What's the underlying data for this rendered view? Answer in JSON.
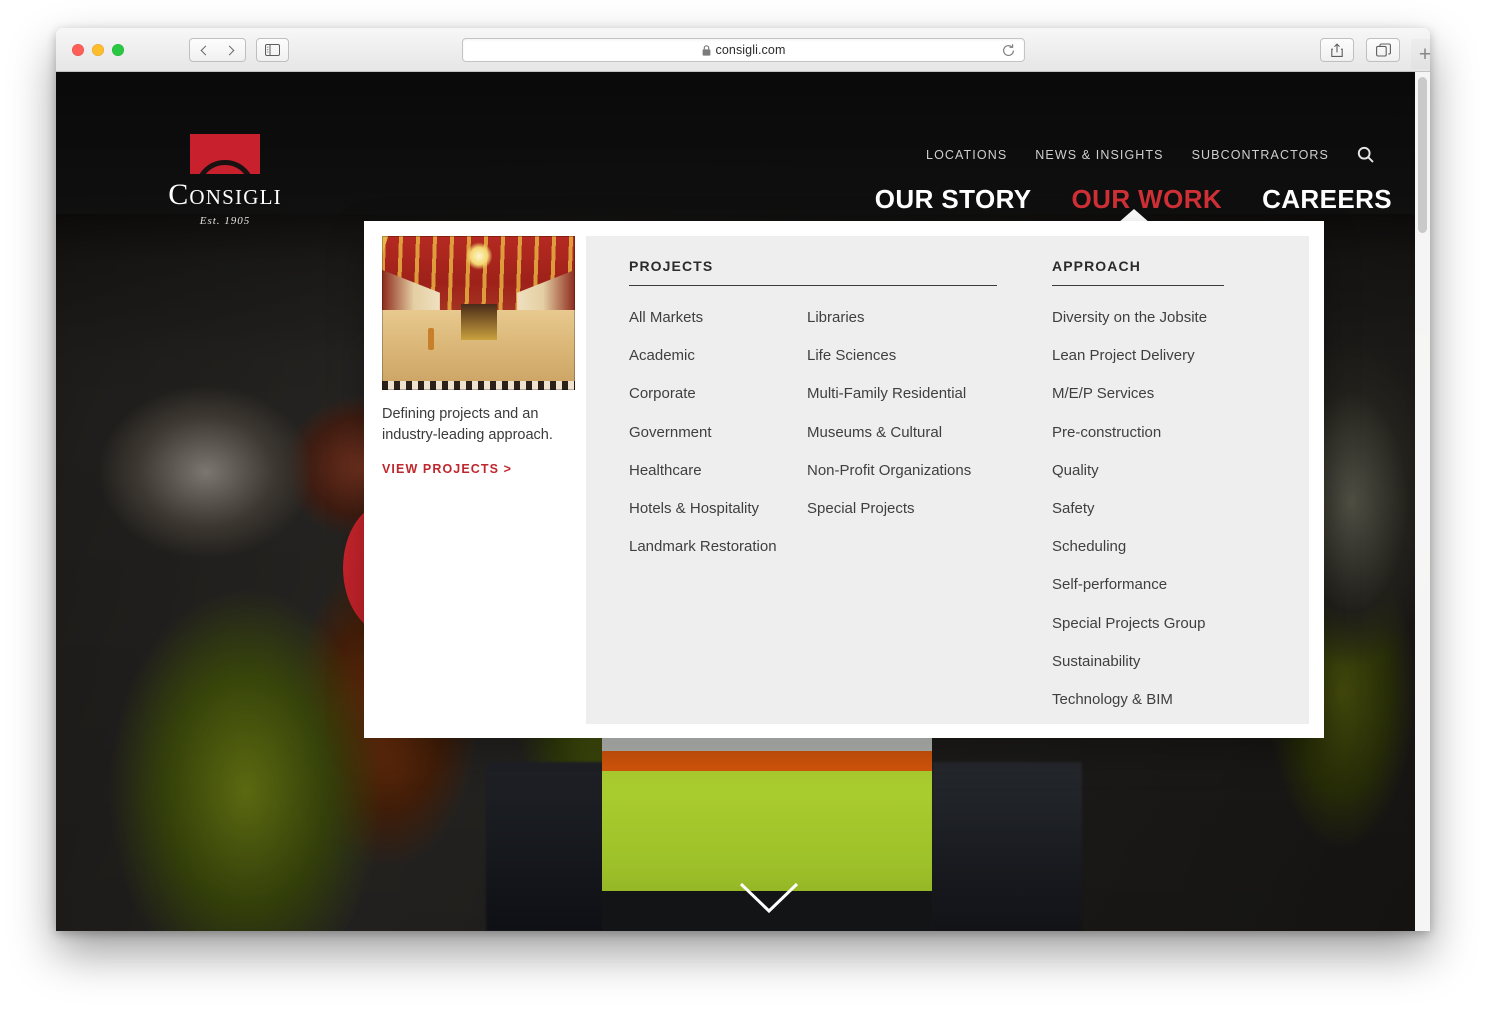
{
  "browser": {
    "url": "consigli.com",
    "lock_icon": "lock-icon",
    "back_icon": "chevron-left-icon",
    "forward_icon": "chevron-right-icon",
    "sidebar_icon": "sidebar-icon",
    "reload_icon": "reload-icon",
    "share_icon": "share-icon",
    "tabs_icon": "tabs-icon",
    "new_tab_label": "+"
  },
  "site": {
    "logo": {
      "wordmark": "Consigli",
      "tagline": "Est. 1905",
      "mark_icon": "arch-logo-icon"
    },
    "utility_nav": [
      {
        "label": "LOCATIONS"
      },
      {
        "label": "NEWS & INSIGHTS"
      },
      {
        "label": "SUBCONTRACTORS"
      }
    ],
    "search_icon": "search-icon",
    "main_nav": [
      {
        "label": "OUR STORY",
        "active": false
      },
      {
        "label": "OUR WORK",
        "active": true
      },
      {
        "label": "CAREERS",
        "active": false
      }
    ]
  },
  "mega_menu": {
    "feature": {
      "image_alt": "ornate-hall-interior",
      "caption": "Defining projects and an industry-leading approach.",
      "link_label": "VIEW PROJECTS >"
    },
    "projects": {
      "heading": "PROJECTS",
      "column_a": [
        "All Markets",
        "Academic",
        "Corporate",
        "Government",
        "Healthcare",
        "Hotels & Hospitality",
        "Landmark Restoration"
      ],
      "column_b": [
        "Libraries",
        "Life Sciences",
        "Multi-Family Residential",
        "Museums & Cultural",
        "Non-Profit Organizations",
        "Special Projects"
      ]
    },
    "approach": {
      "heading": "APPROACH",
      "items": [
        "Diversity on the Jobsite",
        "Lean Project Delivery",
        "M/E/P Services",
        "Pre-construction",
        "Quality",
        "Safety",
        "Scheduling",
        "Self-performance",
        "Special Projects Group",
        "Sustainability",
        "Technology & BIM"
      ]
    }
  },
  "hero": {
    "scroll_icon": "chevron-down-icon"
  },
  "colors": {
    "brand_red": "#c8202c",
    "active_nav_red": "#cf3036",
    "link_red": "#c0272d",
    "panel_grey": "#eeeeee",
    "header_black": "#0f0f0f"
  }
}
